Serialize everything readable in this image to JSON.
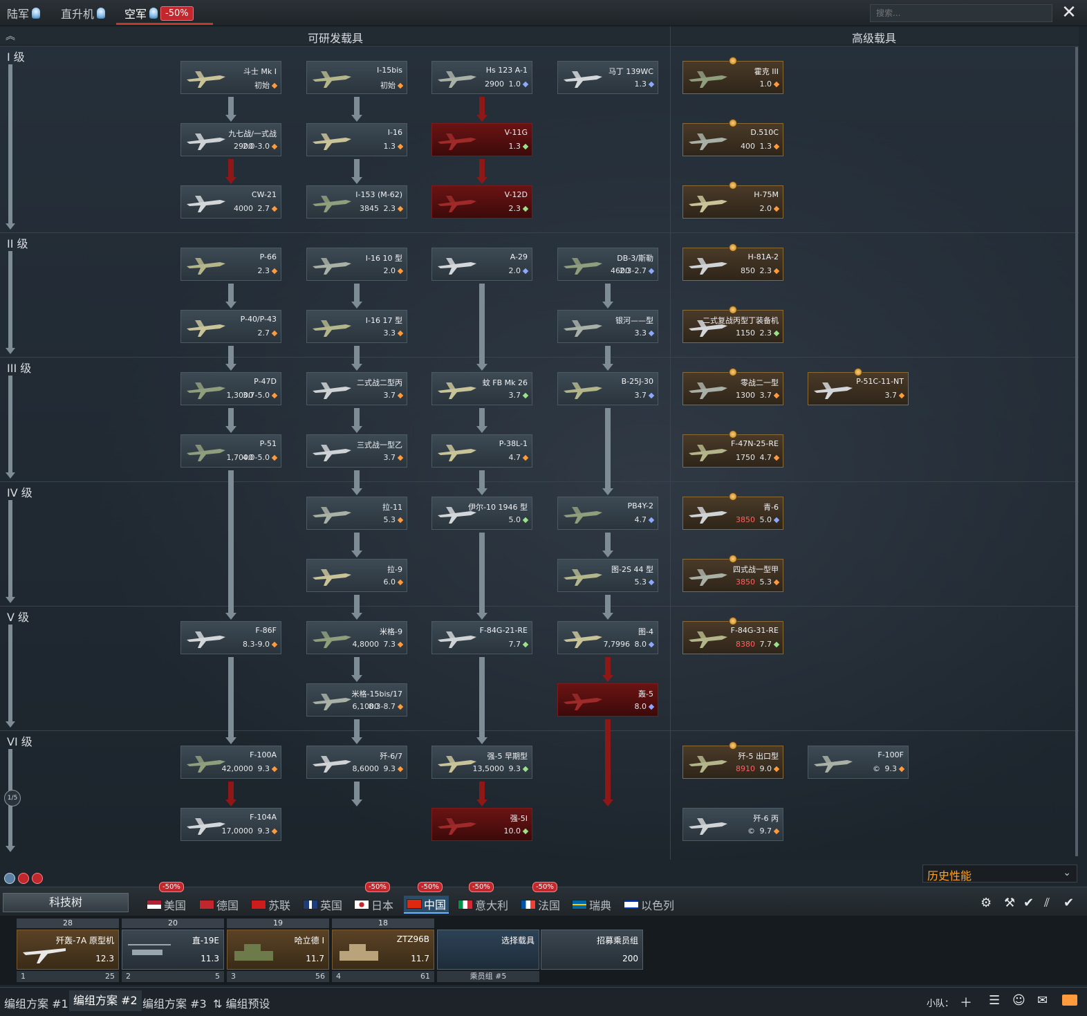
{
  "topbar": {
    "tabs": [
      {
        "label": "陆军"
      },
      {
        "label": "直升机"
      },
      {
        "label": "空军"
      }
    ],
    "air_discount": "-50%",
    "search_placeholder": "搜索...",
    "close": "✕"
  },
  "tree": {
    "col_research": "可研发载具",
    "col_premium": "高级载具",
    "ranks": [
      "I 级",
      "II 级",
      "III 级",
      "IV 级",
      "V 级",
      "VI 级"
    ],
    "page": "1/5",
    "vehicles": {
      "r1a": {
        "name": "斗士 Mk I",
        "cost": "",
        "br": "初始",
        "dot": "orange"
      },
      "r1b": {
        "name": "I-15bis",
        "cost": "",
        "br": "初始",
        "dot": "orange"
      },
      "r1c": {
        "name": "Hs 123 A-1",
        "cost": "2900",
        "br": "1.0",
        "dot": "blue"
      },
      "r1d": {
        "name": "马丁 139WC",
        "cost": "",
        "br": "1.3",
        "dot": "blue"
      },
      "r1p1": {
        "name": "霍克 III",
        "cost": "",
        "br": "1.0",
        "dot": "orange"
      },
      "r2a": {
        "name": "九七战/一式战",
        "cost": "2900",
        "br": "2.0-3.0",
        "dot": "orange"
      },
      "r2b": {
        "name": "I-16",
        "cost": "",
        "br": "1.3",
        "dot": "orange"
      },
      "r2c": {
        "name": "V-11G",
        "cost": "",
        "br": "1.3",
        "dot": "green"
      },
      "r2p1": {
        "name": "D.510C",
        "cost": "400",
        "br": "1.3",
        "dot": "orange"
      },
      "r3a": {
        "name": "CW-21",
        "cost": "4000",
        "br": "2.7",
        "dot": "orange"
      },
      "r3b": {
        "name": "I-153 (M-62)",
        "cost": "3845",
        "br": "2.3",
        "dot": "orange"
      },
      "r3c": {
        "name": "V-12D",
        "cost": "",
        "br": "2.3",
        "dot": "green"
      },
      "r3p1": {
        "name": "H-75M",
        "cost": "",
        "br": "2.0",
        "dot": "orange"
      },
      "r4a": {
        "name": "P-66",
        "cost": "",
        "br": "2.3",
        "dot": "orange"
      },
      "r4b": {
        "name": "I-16 10 型",
        "cost": "",
        "br": "2.0",
        "dot": "orange"
      },
      "r4c": {
        "name": "A-29",
        "cost": "",
        "br": "2.0",
        "dot": "blue"
      },
      "r4d": {
        "name": "DB-3/斯勒",
        "cost": "4600",
        "br": "2.3-2.7",
        "dot": "blue"
      },
      "r4p1": {
        "name": "H-81A-2",
        "cost": "850",
        "br": "2.3",
        "dot": "orange"
      },
      "r5a": {
        "name": "P-40/P-43",
        "cost": "",
        "br": "2.7",
        "dot": "orange"
      },
      "r5b": {
        "name": "I-16 17 型",
        "cost": "",
        "br": "3.3",
        "dot": "orange"
      },
      "r5d": {
        "name": "银河——型",
        "cost": "",
        "br": "3.3",
        "dot": "blue"
      },
      "r5p1": {
        "name": "二式复战丙型丁装备机",
        "cost": "1150",
        "br": "2.3",
        "dot": "green"
      },
      "r6a": {
        "name": "P-47D",
        "cost": "1,3000",
        "br": "3.7-5.0",
        "dot": "orange"
      },
      "r6b": {
        "name": "二式战二型丙",
        "cost": "",
        "br": "3.7",
        "dot": "orange"
      },
      "r6c": {
        "name": "蚊 FB Mk 26",
        "cost": "",
        "br": "3.7",
        "dot": "green"
      },
      "r6d": {
        "name": "B-25J-30",
        "cost": "",
        "br": "3.7",
        "dot": "blue"
      },
      "r6p1": {
        "name": "零战二一型",
        "cost": "1300",
        "br": "3.7",
        "dot": "orange"
      },
      "r6p2": {
        "name": "P-51C-11-NT",
        "cost": "",
        "br": "3.7",
        "dot": "orange"
      },
      "r7a": {
        "name": "P-51",
        "cost": "1,7000",
        "br": "4.0-5.0",
        "dot": "orange"
      },
      "r7b": {
        "name": "三式战一型乙",
        "cost": "",
        "br": "3.7",
        "dot": "orange"
      },
      "r7c": {
        "name": "P-38L-1",
        "cost": "",
        "br": "4.7",
        "dot": "orange"
      },
      "r7p1": {
        "name": "F-47N-25-RE",
        "cost": "1750",
        "br": "4.7",
        "dot": "orange"
      },
      "r8b": {
        "name": "拉-11",
        "cost": "",
        "br": "5.3",
        "dot": "orange"
      },
      "r8c": {
        "name": "伊尔-10 1946 型",
        "cost": "",
        "br": "5.0",
        "dot": "green"
      },
      "r8d": {
        "name": "PB4Y-2",
        "cost": "",
        "br": "4.7",
        "dot": "blue"
      },
      "r8p1": {
        "name": "青-6",
        "cost": "3850",
        "br": "5.0",
        "dot": "blue"
      },
      "r9b": {
        "name": "拉-9",
        "cost": "",
        "br": "6.0",
        "dot": "orange"
      },
      "r9d": {
        "name": "图-2S 44 型",
        "cost": "",
        "br": "5.3",
        "dot": "blue"
      },
      "r9p1": {
        "name": "四式战一型甲",
        "cost": "3850",
        "br": "5.3",
        "dot": "orange"
      },
      "r10a": {
        "name": "F-86F",
        "cost": "",
        "br": "8.3-9.0",
        "dot": "orange"
      },
      "r10b": {
        "name": "米格-9",
        "cost": "4,8000",
        "br": "7.3",
        "dot": "orange"
      },
      "r10c": {
        "name": "F-84G-21-RE",
        "cost": "",
        "br": "7.7",
        "dot": "green"
      },
      "r10d": {
        "name": "图-4",
        "cost": "7,7996",
        "br": "8.0",
        "dot": "blue"
      },
      "r10p1": {
        "name": "F-84G-31-RE",
        "cost": "8380",
        "br": "7.7",
        "dot": "green"
      },
      "r11b": {
        "name": "米格-15bis/17",
        "cost": "6,1000",
        "br": "8.3-8.7",
        "dot": "orange"
      },
      "r11d": {
        "name": "轰-5",
        "cost": "",
        "br": "8.0",
        "dot": "blue"
      },
      "r12a": {
        "name": "F-100A",
        "cost": "42,0000",
        "br": "9.3",
        "dot": "orange"
      },
      "r12b": {
        "name": "歼-6/7",
        "cost": "8,6000",
        "br": "9.3",
        "dot": "orange"
      },
      "r12c": {
        "name": "强-5 早期型",
        "cost": "13,5000",
        "br": "9.3",
        "dot": "green"
      },
      "r12p1": {
        "name": "歼-5 出口型",
        "cost": "8910",
        "br": "9.0",
        "dot": "orange"
      },
      "r12p2": {
        "name": "F-100F",
        "cost": "©",
        "br": "9.3",
        "dot": "orange"
      },
      "r13a": {
        "name": "F-104A",
        "cost": "17,0000",
        "br": "9.3",
        "dot": "orange"
      },
      "r13c": {
        "name": "强-5I",
        "cost": "",
        "br": "10.0",
        "dot": "green"
      },
      "r13p1": {
        "name": "歼-6 丙",
        "cost": "©",
        "br": "9.7",
        "dot": "orange"
      }
    }
  },
  "history_select": "历史性能",
  "nation_bar": {
    "tech_tree": "科技树",
    "nations": [
      "美国",
      "德国",
      "苏联",
      "英国",
      "日本",
      "中国",
      "意大利",
      "法国",
      "瑞典",
      "以色列"
    ],
    "discount": "-50%"
  },
  "crew": {
    "slots": [
      {
        "top": "28",
        "name": "歼轰-7A 原型机",
        "br": "12.3",
        "num": "1",
        "stat": "25"
      },
      {
        "top": "20",
        "name": "直-19E",
        "br": "11.3",
        "num": "2",
        "stat": "5"
      },
      {
        "top": "19",
        "name": "哈立德 I",
        "br": "11.7",
        "num": "3",
        "stat": "56"
      },
      {
        "top": "18",
        "name": "ZTZ96B",
        "br": "11.7",
        "num": "4",
        "stat": "61"
      }
    ],
    "select_vehicle": "选择载具",
    "crew_label": "乘员组 #5",
    "recruit": "招募乘员组",
    "recruit_cost": "200"
  },
  "bottom": {
    "presets": [
      "编组方案 #1",
      "编组方案 #2",
      "编组方案 #3"
    ],
    "preset_setup": "编组预设",
    "squad": "小队："
  }
}
